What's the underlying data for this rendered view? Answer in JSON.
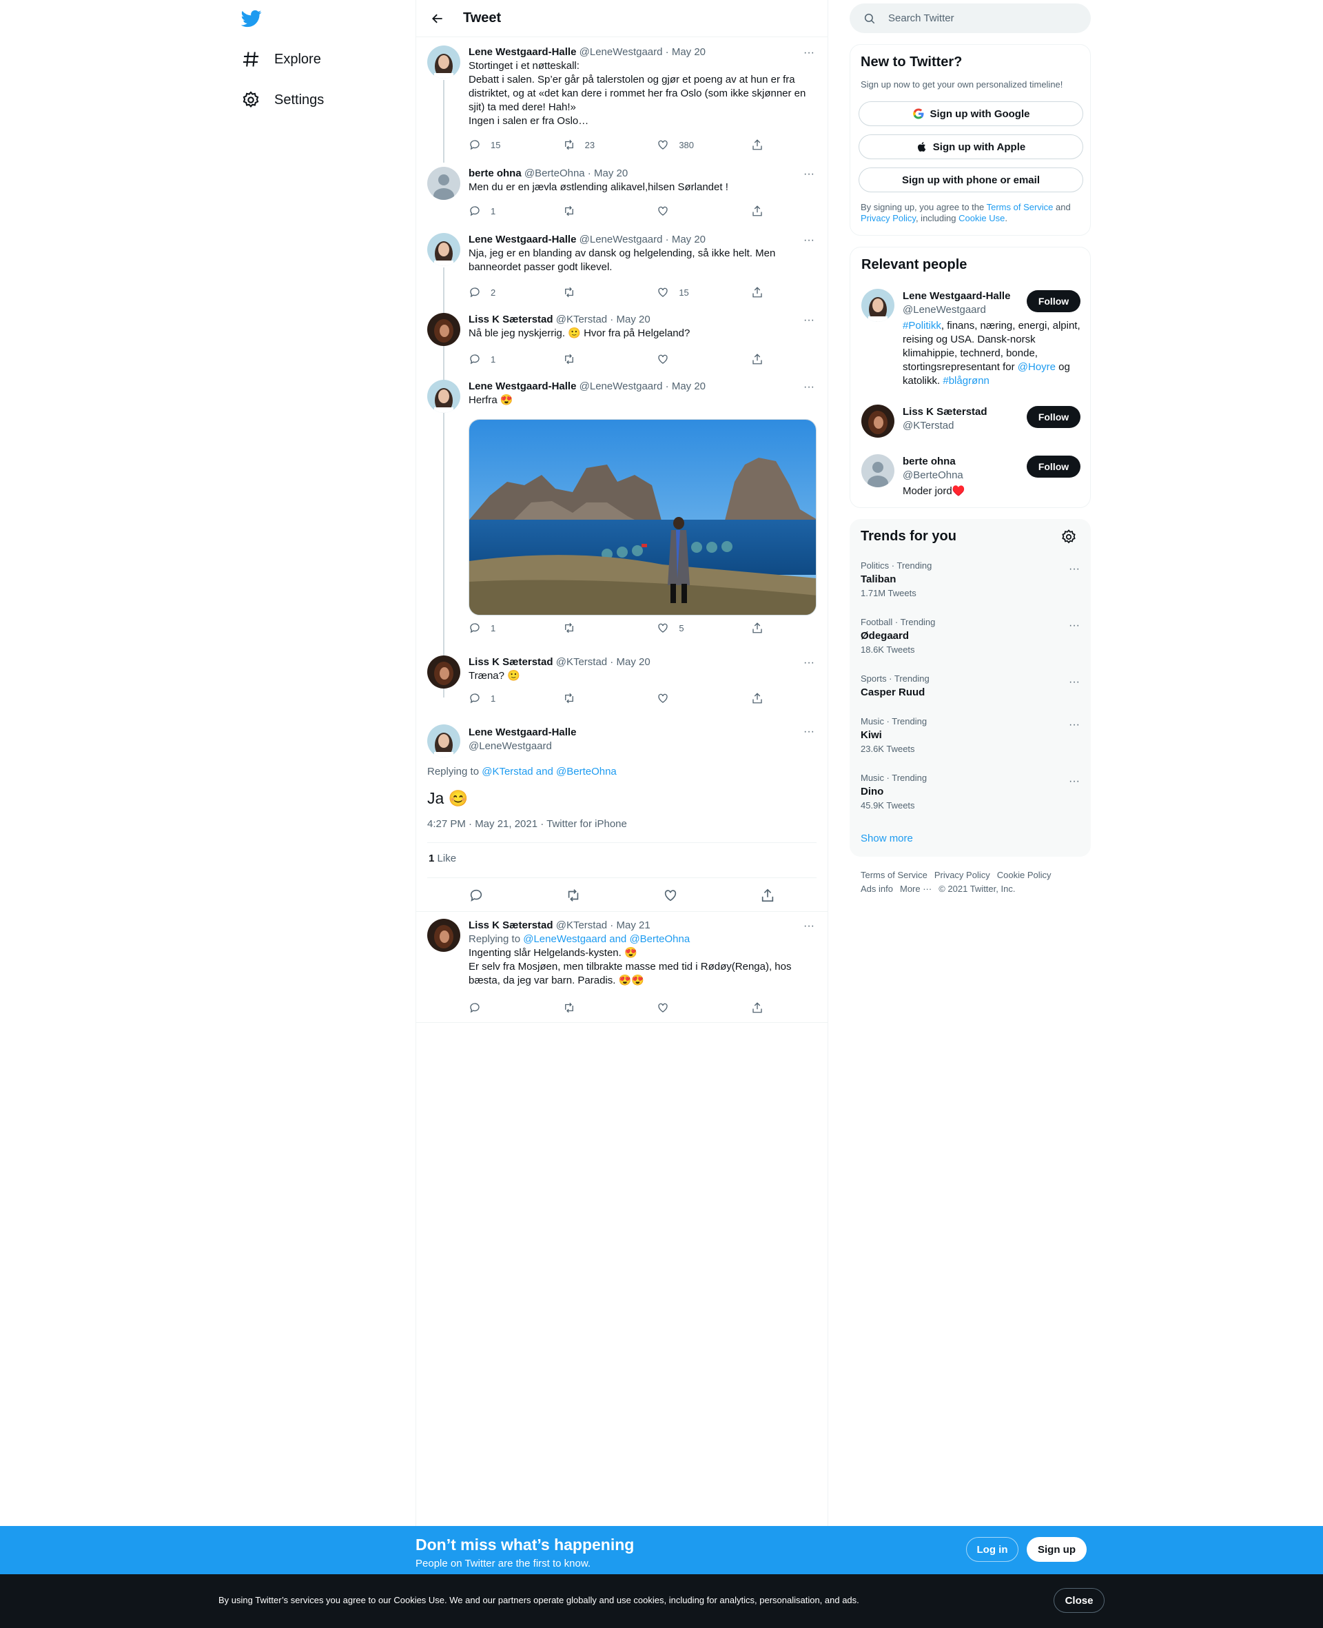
{
  "nav": {
    "explore": "Explore",
    "settings": "Settings"
  },
  "header": {
    "title": "Tweet"
  },
  "tweets": [
    {
      "name": "Lene Westgaard-Halle",
      "handle": "@LeneWestgaard",
      "date": "May 20",
      "text": "Stortinget i et nøtteskall:\nDebatt i salen. Sp’er går på talerstolen og gjør et poeng av at hun er fra distriktet, og at «det kan dere i rommet her fra Oslo (som ikke skjønner en sjit) ta med dere! Hah!»\nIngen i salen er fra Oslo…",
      "replies": "15",
      "retweets": "23",
      "likes": "380"
    },
    {
      "name": "berte ohna",
      "handle": "@BerteOhna",
      "date": "May 20",
      "text": "Men du er en jævla østlending alikavel,hilsen Sørlandet !",
      "replies": "1",
      "retweets": "",
      "likes": ""
    },
    {
      "name": "Lene Westgaard-Halle",
      "handle": "@LeneWestgaard",
      "date": "May 20",
      "text": "Nja, jeg er en blanding av dansk og helgelending, så ikke helt. Men banneordet passer godt likevel.",
      "replies": "2",
      "retweets": "",
      "likes": "15"
    },
    {
      "name": "Liss K Sæterstad",
      "handle": "@KTerstad",
      "date": "May 20",
      "text": "Nå ble jeg nyskjerrig. 🙂 Hvor fra på Helgeland?",
      "replies": "1",
      "retweets": "",
      "likes": ""
    },
    {
      "name": "Lene Westgaard-Halle",
      "handle": "@LeneWestgaard",
      "date": "May 20",
      "text": "Herfra 😍",
      "replies": "1",
      "retweets": "",
      "likes": "5"
    },
    {
      "name": "Liss K Sæterstad",
      "handle": "@KTerstad",
      "date": "May 20",
      "text": "Træna? 🙂",
      "replies": "1",
      "retweets": "",
      "likes": ""
    }
  ],
  "focus": {
    "name": "Lene Westgaard-Halle",
    "handle": "@LeneWestgaard",
    "replying_prefix": "Replying to ",
    "replying_to": "@KTerstad and @BerteOhna",
    "text": "Ja 😊",
    "timestamp": "4:27 PM · May 21, 2021 · Twitter for iPhone",
    "like_count": "1",
    "like_label": "Like"
  },
  "reply": {
    "name": "Liss K Sæterstad",
    "handle": "@KTerstad",
    "date": "May 21",
    "replying_prefix": "Replying to ",
    "replying_to": "@LeneWestgaard and @BerteOhna",
    "text": "Ingenting slår Helgelands-kysten. 😍\nEr selv fra Mosjøen, men tilbrakte masse med tid i Rødøy(Renga), hos bæsta, da jeg var barn. Paradis. 😍😍"
  },
  "search": {
    "placeholder": "Search Twitter"
  },
  "new_to_twitter": {
    "title": "New to Twitter?",
    "subtitle": "Sign up now to get your own personalized timeline!",
    "google": "Sign up with Google",
    "apple": "Sign up with Apple",
    "phone": "Sign up with phone or email",
    "terms_1": "By signing up, you agree to the ",
    "terms_tos": "Terms of Service",
    "terms_2": " and ",
    "terms_privacy": "Privacy Policy",
    "terms_3": ", including ",
    "terms_cookie": "Cookie Use",
    "terms_4": "."
  },
  "relevant": {
    "title": "Relevant people",
    "follow": "Follow",
    "people": [
      {
        "name": "Lene Westgaard-Halle",
        "handle": "@LeneWestgaard",
        "bio_tag1": "#Politikk",
        "bio_1": ", finans, næring, energi, alpint, reising og USA. Dansk-norsk klimahippie, technerd, bonde, stortingsrepresentant for ",
        "bio_mention": "@Hoyre",
        "bio_2": " og katolikk. ",
        "bio_tag2": "#blågrønn"
      },
      {
        "name": "Liss K Sæterstad",
        "handle": "@KTerstad"
      },
      {
        "name": "berte ohna",
        "handle": "@BerteOhna",
        "bio": "Moder jord♥️"
      }
    ]
  },
  "trends": {
    "title": "Trends for you",
    "items": [
      {
        "meta": "Politics · Trending",
        "name": "Taliban",
        "count": "1.71M Tweets"
      },
      {
        "meta": "Football · Trending",
        "name": "Ødegaard",
        "count": "18.6K Tweets"
      },
      {
        "meta": "Sports · Trending",
        "name": "Casper Ruud",
        "count": ""
      },
      {
        "meta": "Music · Trending",
        "name": "Kiwi",
        "count": "23.6K Tweets"
      },
      {
        "meta": "Music · Trending",
        "name": "Dino",
        "count": "45.9K Tweets"
      }
    ],
    "show_more": "Show more"
  },
  "footer": {
    "terms": "Terms of Service",
    "privacy": "Privacy Policy",
    "cookie": "Cookie Policy",
    "ads": "Ads info",
    "more": "More ···",
    "copyright": "© 2021 Twitter, Inc."
  },
  "bottom_bar": {
    "title": "Don’t miss what’s happening",
    "subtitle": "People on Twitter are the first to know.",
    "login": "Log in",
    "signup": "Sign up"
  },
  "cookie_bar": {
    "text": "By using Twitter’s services you agree to our Cookies Use. We and our partners operate globally and use cookies, including for analytics, personalisation, and ads.",
    "close": "Close"
  },
  "colors": {
    "brand": "#1d9bf0",
    "text": "#0f1419",
    "muted": "#536471"
  }
}
